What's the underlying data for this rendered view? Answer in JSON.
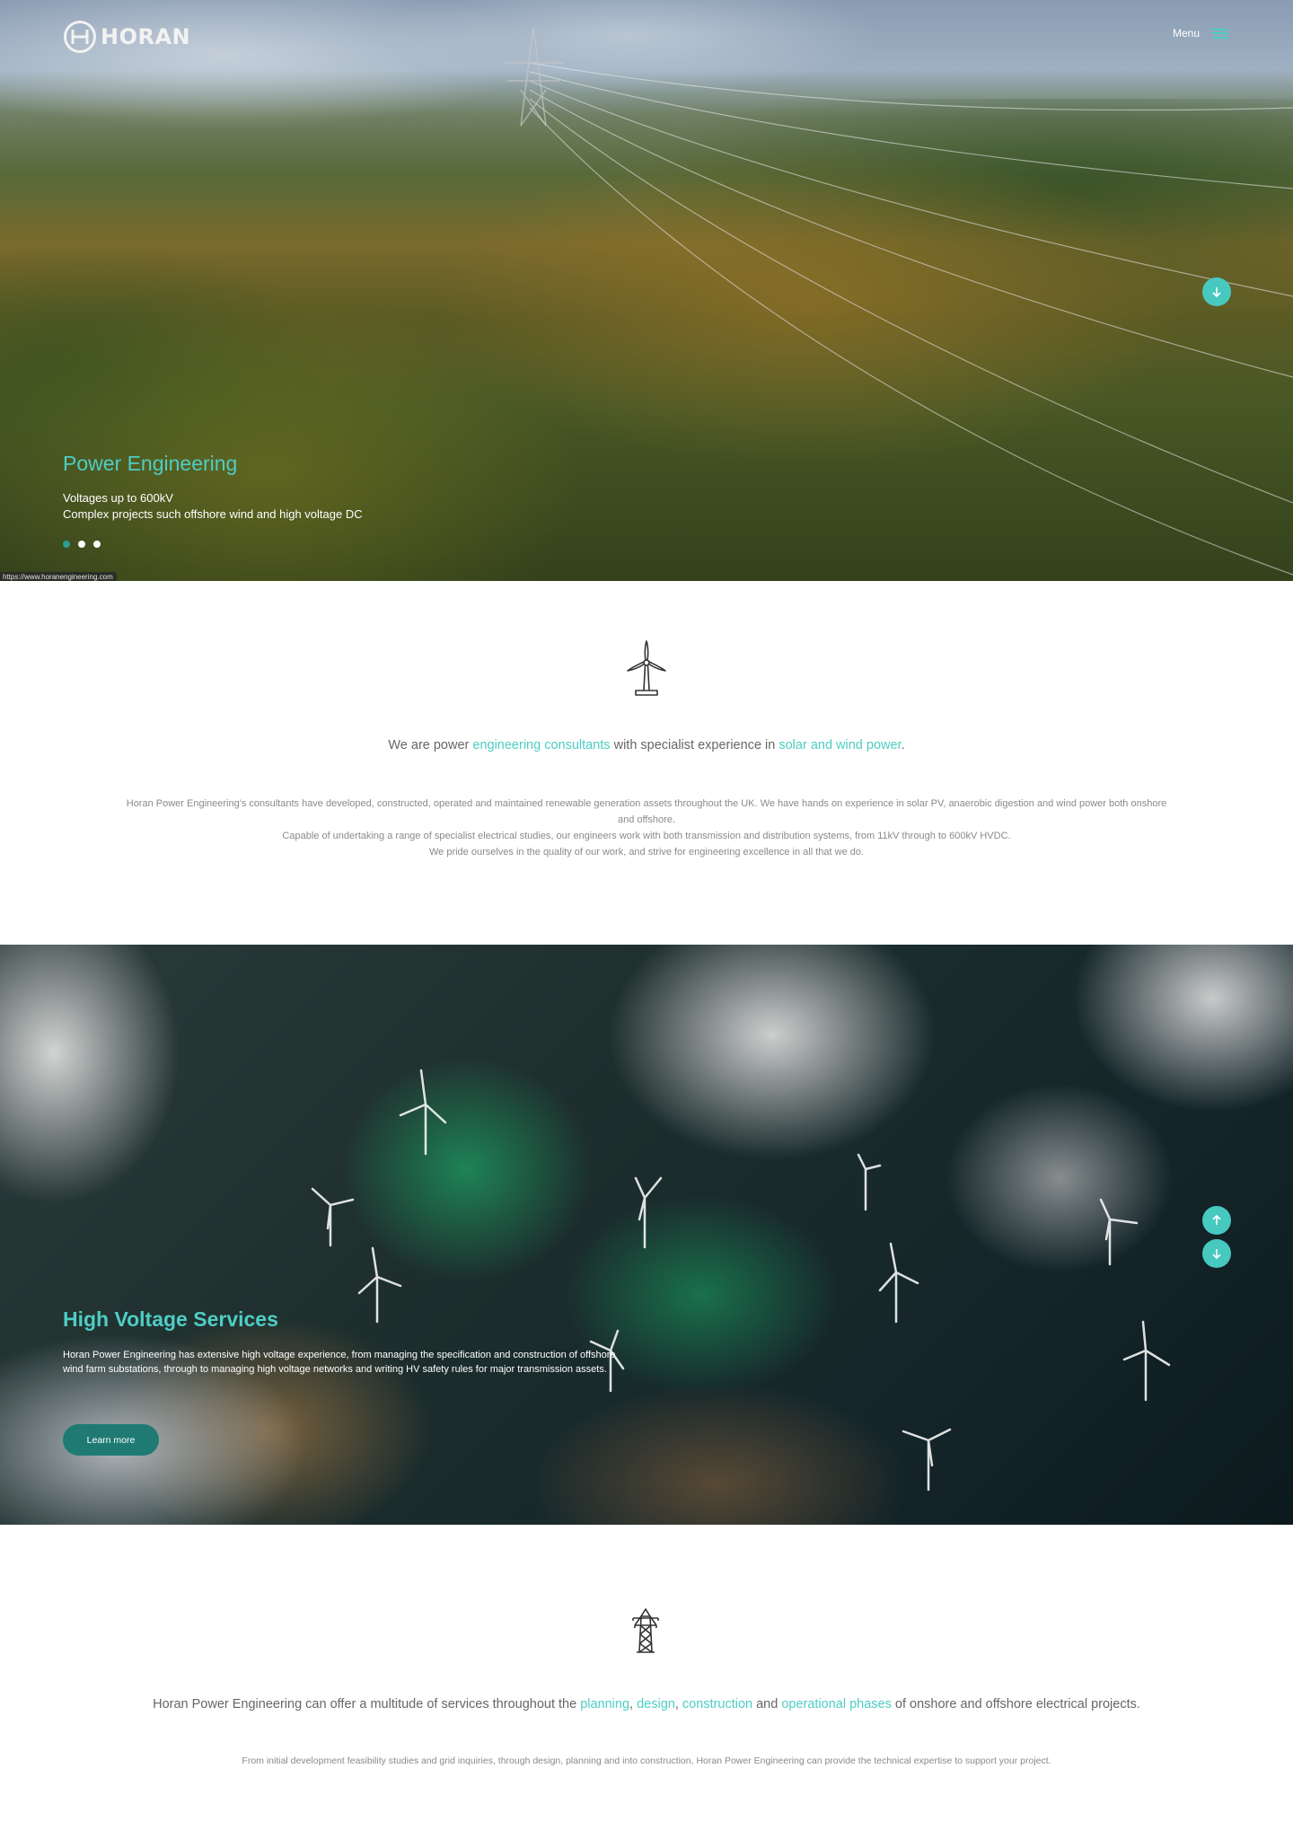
{
  "brand": {
    "name": "HORAN",
    "accent_color": "#4ecdc4",
    "button_color": "#1f7a74"
  },
  "header": {
    "menu_label": "Menu",
    "menu_icon": "hamburger-icon"
  },
  "hero": {
    "title": "Power Engineering",
    "lines": [
      "Voltages up to 600kV",
      "Complex projects such offshore wind and high voltage DC"
    ],
    "slides": {
      "count": 3,
      "active_index": 0
    },
    "scroll_down_icon": "arrow-down-icon"
  },
  "status_bar": {
    "url": "https://www.horanengineering.com"
  },
  "intro": {
    "icon": "wind-turbine-icon",
    "lead": {
      "part1": "We are power ",
      "link1": "engineering consultants",
      "part2": " with specialist experience in ",
      "link2": "solar and wind power",
      "part3": "."
    },
    "body": [
      "Horan Power Engineering's consultants have developed, constructed, operated and maintained renewable generation assets throughout the UK. We have hands on experience in solar PV, anaerobic digestion and wind power both onshore and offshore.",
      "Capable of undertaking a range of specialist electrical studies, our engineers work with both transmission and distribution systems, from 11kV through to 600kV HVDC.",
      "We pride ourselves in the quality of our work, and strive for engineering excellence in all that we do."
    ]
  },
  "high_voltage": {
    "title": "High Voltage Services",
    "text": "Horan Power Engineering has extensive high voltage experience, from managing the specification and construction of offshore wind farm substations, through to managing high voltage networks and writing HV safety rules for major transmission assets.",
    "button_label": "Learn more",
    "scroll_up_icon": "arrow-up-icon",
    "scroll_down_icon": "arrow-down-icon"
  },
  "services": {
    "icon": "pylon-icon",
    "lead": {
      "part1": "Horan Power Engineering can offer a multitude of services throughout the ",
      "link1": "planning",
      "sep1": ", ",
      "link2": "design",
      "sep2": ", ",
      "link3": "construction",
      "part2": " and ",
      "link4": "operational phases",
      "part3": " of onshore and offshore electrical projects."
    },
    "body": "From initial development feasibility studies and grid inquiries, through design, planning and into construction, Horan Power Engineering can provide the technical expertise to support your project."
  }
}
